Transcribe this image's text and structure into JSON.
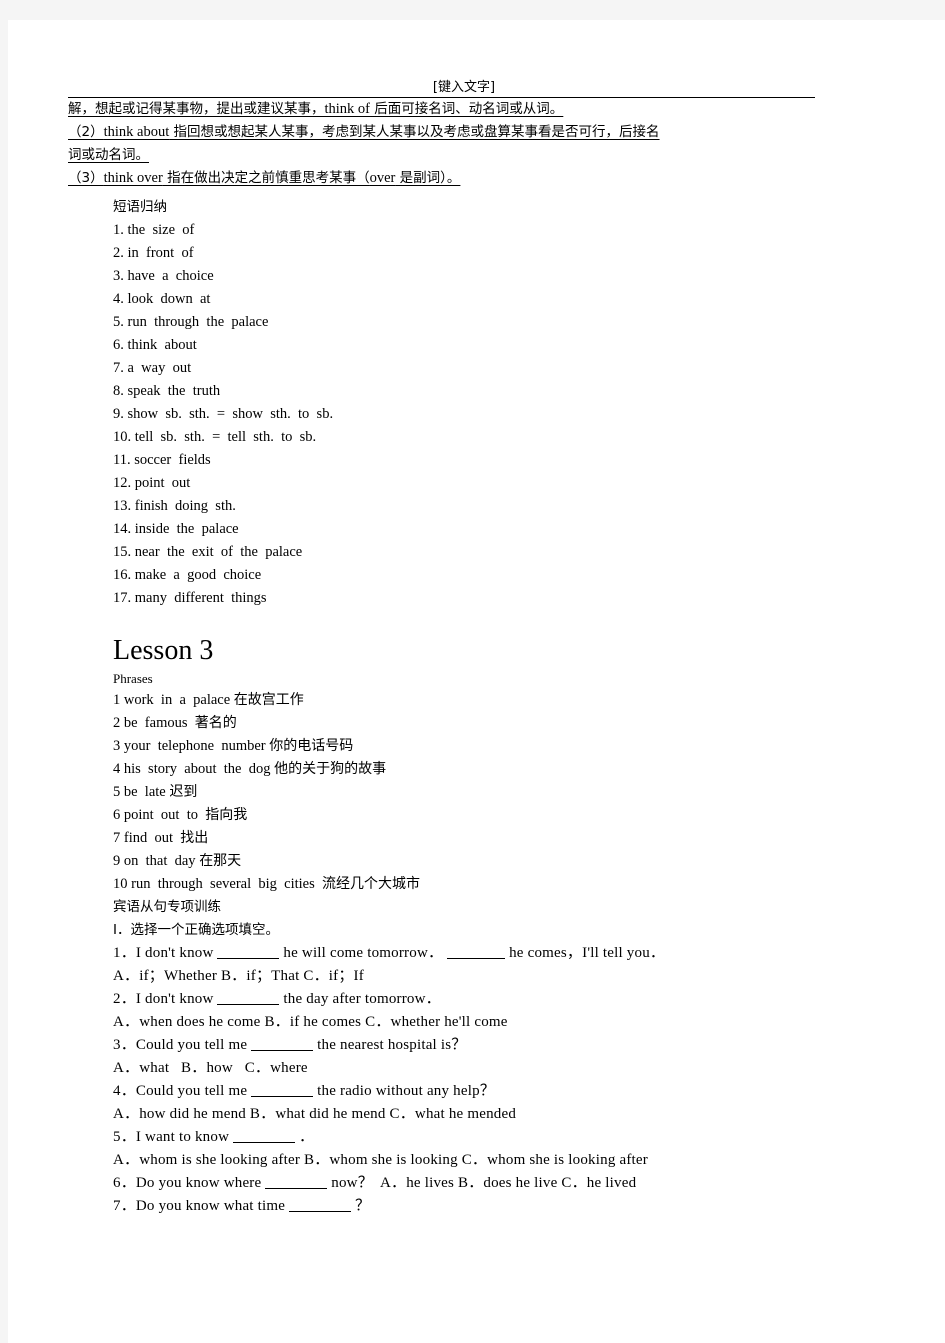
{
  "header": {
    "placeholder_text": "[键入文字]"
  },
  "notes": {
    "lines": [
      "解，想起或记得某事物，提出或建议某事，",
      "（2）think about 指回想或想起某人某事，考虑到某人某事以及考虑或盘算某事看是否可行，后接名",
      "词或动名词。",
      "（3）think over 指在做出决定之前慎重思考某事（over 是副词）。"
    ],
    "line1_prefix": "解，想起或记得某事物，提出或建议某事，",
    "line1_en": "think of",
    "line1_suffix": " 后面可接名词、动名词或从词。",
    "line2_prefix": "（2）",
    "line2_en": "think about",
    "line2_suffix": " 指回想或想起某人某事，考虑到某人某事以及考虑或盘算某事看是否可行，后接名",
    "line3": "词或动名词。",
    "line4_prefix": "（3）",
    "line4_en": "think over",
    "line4_mid": " 指在做出决定之前慎重思考某事（",
    "line4_en2": "over",
    "line4_suffix": " 是副词）。"
  },
  "phrase_summary": {
    "title": "短语归纳",
    "items": [
      "1. the  size  of",
      "2. in  front  of",
      "3. have  a  choice",
      "4. look  down  at",
      "5. run  through  the  palace",
      "6. think  about",
      "7. a  way  out",
      "8. speak  the  truth",
      "9. show  sb.  sth.  =  show  sth.  to  sb.",
      "10. tell  sb.  sth.  =  tell  sth.  to  sb.",
      "11. soccer  fields",
      "12. point  out",
      "13. finish  doing  sth.",
      "14. inside  the  palace",
      "15. near  the  exit  of  the  palace",
      "16. make  a  good  choice",
      "17. many  different  things"
    ]
  },
  "lesson": {
    "heading": "Lesson  3",
    "phrases_label": "Phrases",
    "phrases": [
      {
        "en": "1 work  in  a  palace ",
        "cn": "在故宫工作"
      },
      {
        "en": "2 be  famous  ",
        "cn": "著名的"
      },
      {
        "en": "3 your  telephone  number ",
        "cn": "你的电话号码"
      },
      {
        "en": "4 his  story  about  the  dog ",
        "cn": "他的关于狗的故事"
      },
      {
        "en": "5 be  late ",
        "cn": "迟到"
      },
      {
        "en": "6 point  out  to  ",
        "cn": "指向我"
      },
      {
        "en": "7 find  out  ",
        "cn": "找出"
      },
      {
        "en": "9 on  that  day ",
        "cn": "在那天"
      },
      {
        "en": "10 run  through  several  big  cities  ",
        "cn": "流经几个大城市"
      }
    ]
  },
  "exercises": {
    "section_title": "宾语从句专项训练",
    "instruction": "I．选择一个正确选项填空。",
    "questions": [
      {
        "q_a": "1．I don't know ",
        "q_b": " he will come tomorrow． ",
        "q_c": " he comes，I'll tell you．",
        "blanks": 2
      },
      {
        "q_a": "A．if；Whether B．if；That C．if；If",
        "blanks": 0
      },
      {
        "q_a": "2．I don't know ",
        "q_b": " the day after tomorrow．",
        "blanks": 1
      },
      {
        "q_a": "A．when does he come B．if he comes C．whether he'll come",
        "blanks": 0
      },
      {
        "q_a": "3．Could you tell me ",
        "q_b": " the nearest hospital is？",
        "blanks": 1
      },
      {
        "q_a": "A．what   B．how   C．where",
        "blanks": 0
      },
      {
        "q_a": "4．Could you tell me ",
        "q_b": " the radio without any help？",
        "blanks": 1
      },
      {
        "q_a": "A．how did he mend B．what did he mend C．what he mended",
        "blanks": 0
      },
      {
        "q_a": "5．I want to know ",
        "q_b": " ．",
        "blanks": 1
      },
      {
        "q_a": "A．whom is she looking after B．whom she is looking C．whom she is looking after",
        "blanks": 0
      },
      {
        "q_a": "6．Do you know where ",
        "q_b": " now？  A．he lives B．does he live C．he lived",
        "blanks": 1
      },
      {
        "q_a": "7．Do you know what time ",
        "q_b": " ？",
        "blanks": 1
      }
    ]
  }
}
